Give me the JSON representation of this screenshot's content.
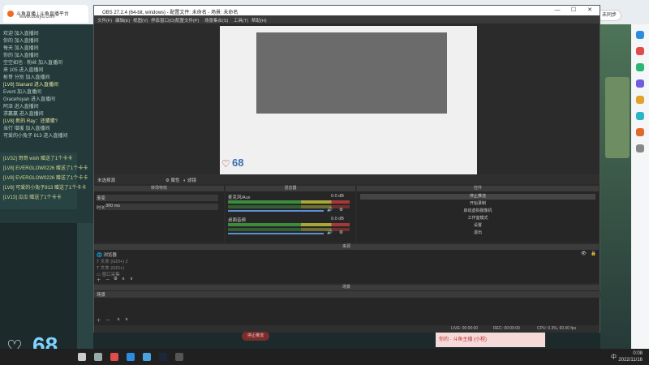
{
  "browser": {
    "tab_title": "斗鱼直播 | 斗鱼直播平台",
    "address": "www.douyu.com",
    "login_label": "未同步",
    "brand_color": "#f26a22"
  },
  "chat": {
    "messages": [
      "欢迎 加入直播间",
      "你的 加入直播间",
      "每天 加入直播间",
      "你的 加入直播间",
      "空空如也 · 粉丝 加入直播间",
      "来 105 进入直播间",
      "彬哥 分别 加入直播间",
      "[LV8] Stanard 进入直播间",
      "Event 加入直播间",
      "Gracehsyan 进入直播间",
      "阿泽 进入直播间",
      "求赢赢 进入直播间",
      "[LV8] 新的 Ray：还猜猜?",
      "当行 增援 加入直播间",
      "可爱的小兔子 813 进入直播间"
    ],
    "gifts": [
      "[LV32] 哥哥 wish 赠送了1个卡卡",
      "[LV8] EVERGLOW0226 赠送了1个卡卡",
      "[LV8] EVERGLOW0226 赠送了1个卡卡",
      "[LV8] 可爱的小兔子813 赠送了1个卡卡",
      "[LV13] 瓜瓜 赠送了1个卡卡"
    ]
  },
  "overlay": {
    "heart_icon": "heart-outline-icon",
    "count": "68",
    "preview_count": "68",
    "notification": "你的 · 斗鱼主播 (小程)"
  },
  "obs": {
    "window_title": "OBS 27.2.4 (64-bit, windows) - 配置文件: 未命名 - 场景: 未命名",
    "menu": [
      "文件(F)",
      "编辑(E)",
      "视图(V)",
      "停靠窗口(D)",
      "配置文件(P)",
      "场景集合(S)",
      "工具(T)",
      "帮助(H)"
    ],
    "source_bar": {
      "label": "未选择源",
      "properties": "属性",
      "filters": "滤镜"
    },
    "transitions": {
      "header": "转场特效",
      "selected": "渐变",
      "duration_label": "时长",
      "duration_value": "300 ms"
    },
    "mixer": {
      "header": "混音器",
      "channels": [
        {
          "name": "麦克风/Aux",
          "db": "0.0 dB",
          "level": 0.6
        },
        {
          "name": "桌面音频",
          "db": "0.0 dB",
          "level": 0.55
        }
      ]
    },
    "controls": {
      "header": "控件",
      "buttons": [
        "停止推流",
        "开始录制",
        "启动虚拟摄像机",
        "工作室模式",
        "设置",
        "退出"
      ]
    },
    "scenes": {
      "header": "来源",
      "items": [
        "浏览器",
        "文本 (GDI+) 2",
        "文本 (GDI+)",
        "窗口采集"
      ]
    },
    "scenes_panel": {
      "header": "场景",
      "items": [
        "场景"
      ]
    },
    "status": {
      "live": "LIVE: 00:00:00",
      "rec": "REC: 00:00:00",
      "cpu": "CPU: 0.3%, 60.00 fps"
    },
    "stop_button": "停止推流"
  },
  "taskbar": {
    "time": "0:08",
    "date": "2022/11/16",
    "lang": "中"
  }
}
